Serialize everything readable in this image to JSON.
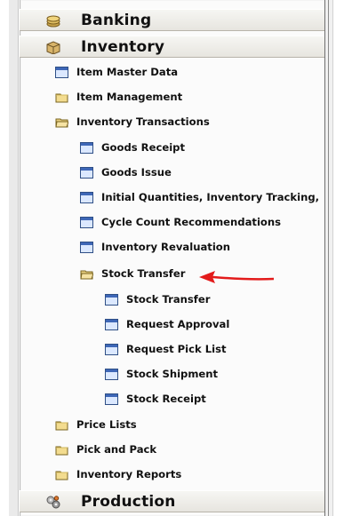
{
  "modules": {
    "banking": {
      "label": "Banking",
      "icon": "coins-icon"
    },
    "inventory": {
      "label": "Inventory",
      "icon": "package-icon"
    },
    "production": {
      "label": "Production",
      "icon": "gears-icon"
    }
  },
  "inventory_items": [
    {
      "label": "Item Master Data",
      "icon": "window-icon"
    },
    {
      "label": "Item Management",
      "icon": "folder-icon"
    },
    {
      "label": "Inventory Transactions",
      "icon": "folder-open-icon"
    }
  ],
  "inventory_transactions": [
    {
      "label": "Goods Receipt",
      "icon": "window-icon"
    },
    {
      "label": "Goods Issue",
      "icon": "window-icon"
    },
    {
      "label": "Initial Quantities, Inventory Tracking,",
      "icon": "window-icon"
    },
    {
      "label": "Cycle Count Recommendations",
      "icon": "window-icon"
    },
    {
      "label": "Inventory Revaluation",
      "icon": "window-icon"
    },
    {
      "label": "Stock Transfer",
      "icon": "folder-open-icon"
    }
  ],
  "stock_transfer_items": [
    {
      "label": "Stock Transfer",
      "icon": "window-icon"
    },
    {
      "label": "Request Approval",
      "icon": "window-icon"
    },
    {
      "label": "Request Pick List",
      "icon": "window-icon"
    },
    {
      "label": "Stock Shipment",
      "icon": "window-icon"
    },
    {
      "label": "Stock Receipt",
      "icon": "window-icon"
    }
  ],
  "inventory_more": [
    {
      "label": "Price Lists",
      "icon": "folder-icon"
    },
    {
      "label": "Pick and Pack",
      "icon": "folder-icon"
    },
    {
      "label": "Inventory Reports",
      "icon": "folder-icon"
    }
  ],
  "colors": {
    "accent_arrow": "#e31b1b",
    "window_icon_border": "#2f4f86",
    "folder_yellow": "#f3dc8f"
  }
}
